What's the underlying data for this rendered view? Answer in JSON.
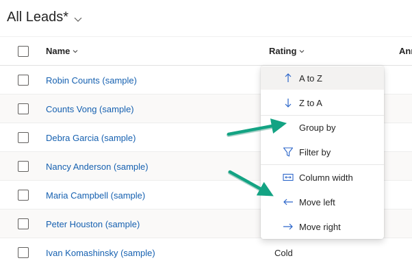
{
  "view": {
    "title": "All Leads*"
  },
  "grid": {
    "columns": {
      "name": "Name",
      "rating": "Rating",
      "annual": "Ann"
    },
    "rows": [
      {
        "name": "Robin Counts (sample)",
        "rating": ""
      },
      {
        "name": "Counts Vong (sample)",
        "rating": ""
      },
      {
        "name": "Debra Garcia (sample)",
        "rating": ""
      },
      {
        "name": "Nancy Anderson (sample)",
        "rating": ""
      },
      {
        "name": "Maria Campbell (sample)",
        "rating": ""
      },
      {
        "name": "Peter Houston (sample)",
        "rating": ""
      },
      {
        "name": "Ivan Komashinsky (sample)",
        "rating": "Cold"
      }
    ]
  },
  "column_menu": {
    "items": [
      {
        "label": "A to Z",
        "icon": "arrow-up-icon"
      },
      {
        "label": "Z to A",
        "icon": "arrow-down-icon"
      },
      {
        "label": "Group by",
        "icon": ""
      },
      {
        "label": "Filter by",
        "icon": "filter-icon"
      },
      {
        "label": "Column width",
        "icon": "column-width-icon"
      },
      {
        "label": "Move left",
        "icon": "arrow-left-icon"
      },
      {
        "label": "Move right",
        "icon": "arrow-right-icon"
      }
    ]
  },
  "colors": {
    "link": "#1560b0",
    "icon_blue": "#2b65c9",
    "annotation_arrow": "#13a383"
  }
}
